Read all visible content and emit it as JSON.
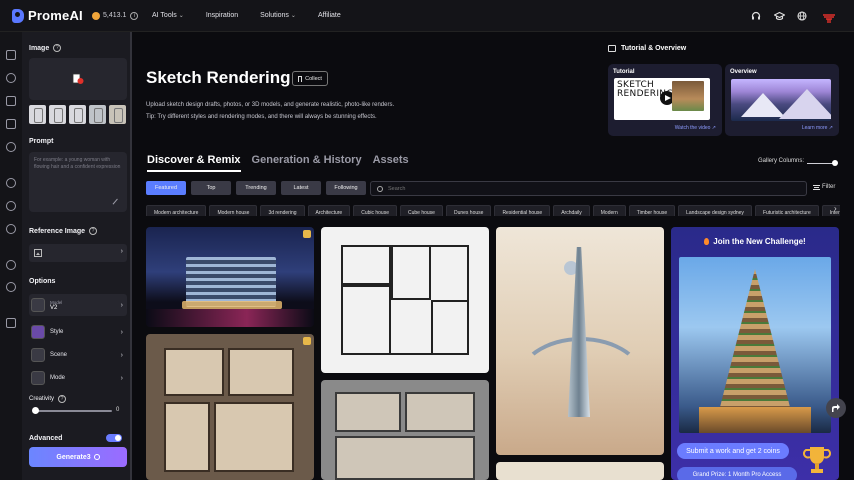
{
  "app": {
    "name": "PromeAI",
    "coins": "5,413.1"
  },
  "nav": {
    "items": [
      {
        "label": "AI Tools",
        "caret": true
      },
      {
        "label": "Inspiration",
        "caret": false
      },
      {
        "label": "Solutions",
        "caret": true
      },
      {
        "label": "Affiliate",
        "caret": false
      }
    ]
  },
  "panel": {
    "image_label": "Image",
    "prompt_label": "Prompt",
    "prompt_placeholder": "For example: a young woman with flowing hair and a confident expression",
    "reference_label": "Reference Image",
    "options_label": "Options",
    "model_title": "Model",
    "model_value": "V2",
    "style_label": "Style",
    "scene_label": "Scene",
    "mode_label": "Mode",
    "creativity_label": "Creativity",
    "creativity_value": "0",
    "advanced_label": "Advanced",
    "generate_label": "Generate3"
  },
  "main": {
    "title": "Sketch Rendering",
    "collect_label": "Collect",
    "desc_line1": "Upload sketch design drafts, photos, or 3D models, and generate realistic, photo-like renders.",
    "desc_line2": "Tip: Try different styles and rendering modes, and there will always be stunning effects.",
    "tutorial_heading": "Tutorial & Overview",
    "tutorial_card": {
      "caption": "Tutorial",
      "thumb_text_1": "SKETCH",
      "thumb_text_2": "RENDERING",
      "link": "Watch the video ↗"
    },
    "overview_card": {
      "caption": "Overview",
      "link": "Learn more ↗"
    },
    "tabs": [
      "Discover & Remix",
      "Generation & History",
      "Assets"
    ],
    "gallery_columns_label": "Gallery Columns:",
    "filters": [
      "Featured",
      "Top",
      "Trending",
      "Latest",
      "Following"
    ],
    "search_placeholder": "Search",
    "filter_label": "Filter",
    "chips": [
      "Modern architecture",
      "Modern house",
      "3d rendering",
      "Architecture",
      "Cubic house",
      "Cube house",
      "Dunes house",
      "Residential house",
      "Archdaily",
      "Modern",
      "Timber house",
      "Landscape design sydney",
      "Futuristic architecture",
      "Interior mode"
    ],
    "challenge": {
      "title": "Join the New Challenge!",
      "cta": "Submit a work and get 2 coins",
      "prize": "Grand Prize: 1 Month Pro Access"
    }
  },
  "colors": {
    "accent": "#5a7dff",
    "background": "#0b0b0f",
    "panel": "#1b1b21",
    "challenge": "#3d2fa8"
  }
}
